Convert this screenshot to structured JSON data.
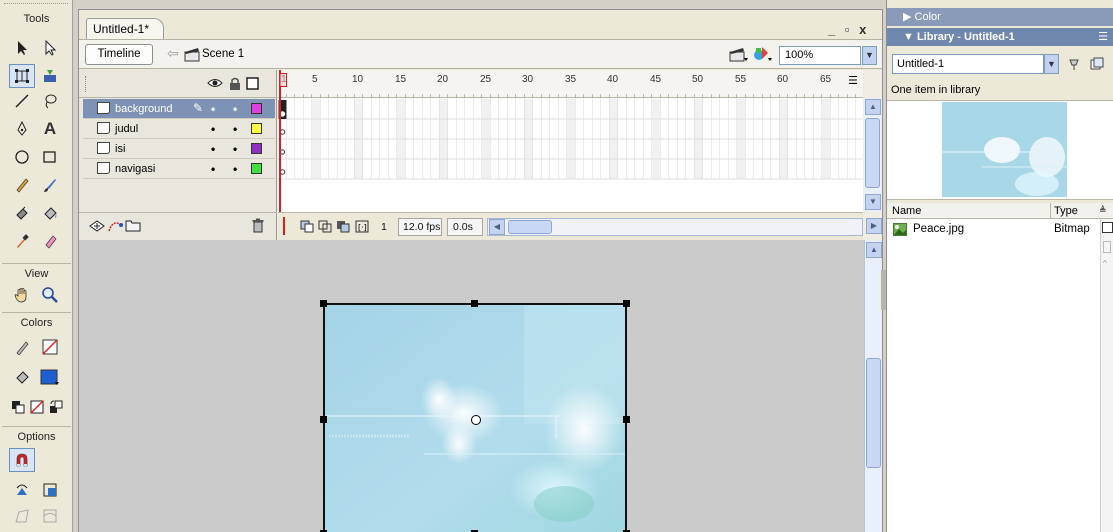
{
  "tools_panel": {
    "title": "Tools",
    "sections": {
      "view": "View",
      "colors": "Colors",
      "options": "Options"
    }
  },
  "document": {
    "tab_title": "Untitled-1*",
    "window_controls": "_ ▫ x",
    "timeline_button": "Timeline",
    "scene_label": "Scene 1",
    "zoom": "100%"
  },
  "timeline": {
    "layers": [
      {
        "name": "background",
        "selected": true,
        "color": "#e040e0"
      },
      {
        "name": "judul",
        "selected": false,
        "color": "#ffff40"
      },
      {
        "name": "isi",
        "selected": false,
        "color": "#9030c0"
      },
      {
        "name": "navigasi",
        "selected": false,
        "color": "#40e040"
      }
    ],
    "ruler_numbers": [
      "1",
      "5",
      "10",
      "15",
      "20",
      "25",
      "30",
      "35",
      "40",
      "45",
      "50",
      "55",
      "60",
      "65"
    ],
    "current_frame": "1",
    "frame_rate": "12.0 fps",
    "elapsed": "0.0s"
  },
  "panels": {
    "color_header": "Color",
    "library_header": "Library - Untitled-1",
    "library_select": "Untitled-1",
    "library_count": "One item in library",
    "columns": {
      "name": "Name",
      "type": "Type"
    },
    "items": [
      {
        "name": "Peace.jpg",
        "type": "Bitmap"
      }
    ]
  },
  "colors": {
    "accent": "#7087ad",
    "stage_bg": "#cbcbcb",
    "bitmap_sky": "#a8d8e8",
    "fill_color": "#1f5fd4"
  }
}
